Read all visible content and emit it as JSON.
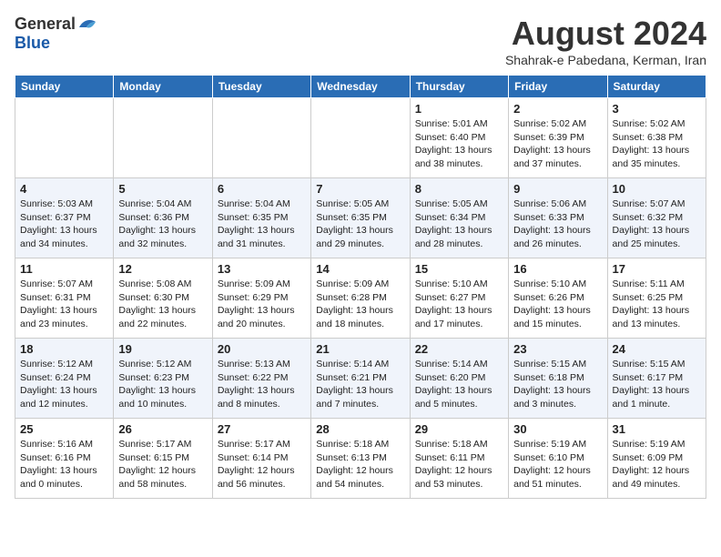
{
  "header": {
    "logo_general": "General",
    "logo_blue": "Blue",
    "month_year": "August 2024",
    "location": "Shahrak-e Pabedana, Kerman, Iran"
  },
  "weekdays": [
    "Sunday",
    "Monday",
    "Tuesday",
    "Wednesday",
    "Thursday",
    "Friday",
    "Saturday"
  ],
  "weeks": [
    [
      {
        "day": "",
        "info": ""
      },
      {
        "day": "",
        "info": ""
      },
      {
        "day": "",
        "info": ""
      },
      {
        "day": "",
        "info": ""
      },
      {
        "day": "1",
        "info": "Sunrise: 5:01 AM\nSunset: 6:40 PM\nDaylight: 13 hours\nand 38 minutes."
      },
      {
        "day": "2",
        "info": "Sunrise: 5:02 AM\nSunset: 6:39 PM\nDaylight: 13 hours\nand 37 minutes."
      },
      {
        "day": "3",
        "info": "Sunrise: 5:02 AM\nSunset: 6:38 PM\nDaylight: 13 hours\nand 35 minutes."
      }
    ],
    [
      {
        "day": "4",
        "info": "Sunrise: 5:03 AM\nSunset: 6:37 PM\nDaylight: 13 hours\nand 34 minutes."
      },
      {
        "day": "5",
        "info": "Sunrise: 5:04 AM\nSunset: 6:36 PM\nDaylight: 13 hours\nand 32 minutes."
      },
      {
        "day": "6",
        "info": "Sunrise: 5:04 AM\nSunset: 6:35 PM\nDaylight: 13 hours\nand 31 minutes."
      },
      {
        "day": "7",
        "info": "Sunrise: 5:05 AM\nSunset: 6:35 PM\nDaylight: 13 hours\nand 29 minutes."
      },
      {
        "day": "8",
        "info": "Sunrise: 5:05 AM\nSunset: 6:34 PM\nDaylight: 13 hours\nand 28 minutes."
      },
      {
        "day": "9",
        "info": "Sunrise: 5:06 AM\nSunset: 6:33 PM\nDaylight: 13 hours\nand 26 minutes."
      },
      {
        "day": "10",
        "info": "Sunrise: 5:07 AM\nSunset: 6:32 PM\nDaylight: 13 hours\nand 25 minutes."
      }
    ],
    [
      {
        "day": "11",
        "info": "Sunrise: 5:07 AM\nSunset: 6:31 PM\nDaylight: 13 hours\nand 23 minutes."
      },
      {
        "day": "12",
        "info": "Sunrise: 5:08 AM\nSunset: 6:30 PM\nDaylight: 13 hours\nand 22 minutes."
      },
      {
        "day": "13",
        "info": "Sunrise: 5:09 AM\nSunset: 6:29 PM\nDaylight: 13 hours\nand 20 minutes."
      },
      {
        "day": "14",
        "info": "Sunrise: 5:09 AM\nSunset: 6:28 PM\nDaylight: 13 hours\nand 18 minutes."
      },
      {
        "day": "15",
        "info": "Sunrise: 5:10 AM\nSunset: 6:27 PM\nDaylight: 13 hours\nand 17 minutes."
      },
      {
        "day": "16",
        "info": "Sunrise: 5:10 AM\nSunset: 6:26 PM\nDaylight: 13 hours\nand 15 minutes."
      },
      {
        "day": "17",
        "info": "Sunrise: 5:11 AM\nSunset: 6:25 PM\nDaylight: 13 hours\nand 13 minutes."
      }
    ],
    [
      {
        "day": "18",
        "info": "Sunrise: 5:12 AM\nSunset: 6:24 PM\nDaylight: 13 hours\nand 12 minutes."
      },
      {
        "day": "19",
        "info": "Sunrise: 5:12 AM\nSunset: 6:23 PM\nDaylight: 13 hours\nand 10 minutes."
      },
      {
        "day": "20",
        "info": "Sunrise: 5:13 AM\nSunset: 6:22 PM\nDaylight: 13 hours\nand 8 minutes."
      },
      {
        "day": "21",
        "info": "Sunrise: 5:14 AM\nSunset: 6:21 PM\nDaylight: 13 hours\nand 7 minutes."
      },
      {
        "day": "22",
        "info": "Sunrise: 5:14 AM\nSunset: 6:20 PM\nDaylight: 13 hours\nand 5 minutes."
      },
      {
        "day": "23",
        "info": "Sunrise: 5:15 AM\nSunset: 6:18 PM\nDaylight: 13 hours\nand 3 minutes."
      },
      {
        "day": "24",
        "info": "Sunrise: 5:15 AM\nSunset: 6:17 PM\nDaylight: 13 hours\nand 1 minute."
      }
    ],
    [
      {
        "day": "25",
        "info": "Sunrise: 5:16 AM\nSunset: 6:16 PM\nDaylight: 13 hours\nand 0 minutes."
      },
      {
        "day": "26",
        "info": "Sunrise: 5:17 AM\nSunset: 6:15 PM\nDaylight: 12 hours\nand 58 minutes."
      },
      {
        "day": "27",
        "info": "Sunrise: 5:17 AM\nSunset: 6:14 PM\nDaylight: 12 hours\nand 56 minutes."
      },
      {
        "day": "28",
        "info": "Sunrise: 5:18 AM\nSunset: 6:13 PM\nDaylight: 12 hours\nand 54 minutes."
      },
      {
        "day": "29",
        "info": "Sunrise: 5:18 AM\nSunset: 6:11 PM\nDaylight: 12 hours\nand 53 minutes."
      },
      {
        "day": "30",
        "info": "Sunrise: 5:19 AM\nSunset: 6:10 PM\nDaylight: 12 hours\nand 51 minutes."
      },
      {
        "day": "31",
        "info": "Sunrise: 5:19 AM\nSunset: 6:09 PM\nDaylight: 12 hours\nand 49 minutes."
      }
    ]
  ]
}
